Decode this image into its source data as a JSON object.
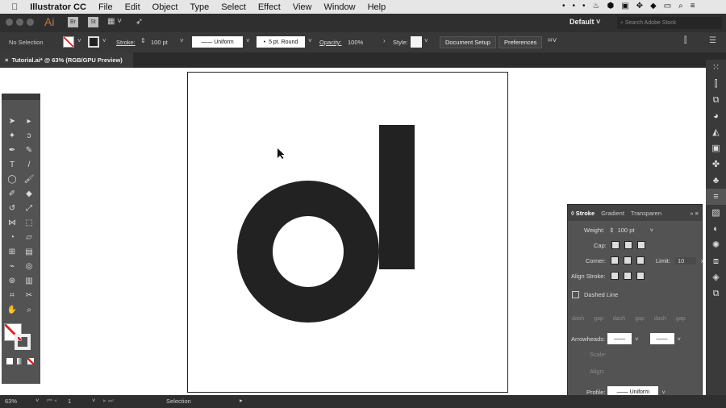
{
  "menubar": {
    "apple": "",
    "app": "Illustrator CC",
    "items": [
      "File",
      "Edit",
      "Object",
      "Type",
      "Select",
      "Effect",
      "View",
      "Window",
      "Help"
    ],
    "status_icons": [
      "more-icon",
      "flame-icon",
      "dropbox-icon",
      "screen-icon",
      "move-icon",
      "wifi-icon",
      "battery-icon",
      "search-icon",
      "list-icon"
    ]
  },
  "appbar": {
    "logo": "Ai",
    "bridge": "Br",
    "stock": "St",
    "workspace": "Default",
    "search_placeholder": "Search Adobe Stock"
  },
  "control": {
    "selection": "No Selection",
    "stroke_label": "Stroke:",
    "stroke_weight": "100 pt",
    "profile": "Uniform",
    "brush": "5 pt. Round",
    "opacity_label": "Opacity:",
    "opacity": "100%",
    "style_label": "Style:",
    "document_setup": "Document Setup",
    "preferences": "Preferences"
  },
  "tab": {
    "title": "Tutorial.ai* @ 63% (RGB/GPU Preview)"
  },
  "panel": {
    "tabs": [
      "Stroke",
      "Gradient",
      "Transparen"
    ],
    "weight_label": "Weight:",
    "weight": "100 pt",
    "cap_label": "Cap:",
    "corner_label": "Corner:",
    "limit_label": "Limit:",
    "limit": "10",
    "limit_unit": "x",
    "align_label": "Align Stroke:",
    "dashed_label": "Dashed Line",
    "dash_labels": [
      "dash",
      "gap",
      "dash",
      "gap",
      "dash",
      "gap"
    ],
    "arrowheads_label": "Arrowheads:",
    "scale_label": "Scale:",
    "align2_label": "Align:",
    "profile_label": "Profile:",
    "profile": "Uniform"
  },
  "status": {
    "zoom": "63%",
    "page": "1",
    "tool": "Selection"
  },
  "colors": {
    "shape": "#222222",
    "accent": "#c8502a"
  }
}
